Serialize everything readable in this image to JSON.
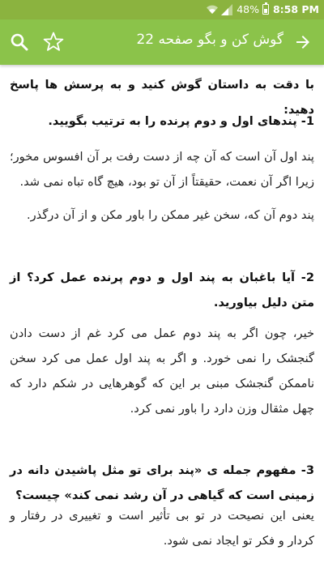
{
  "status_bar": {
    "time": "8:58 PM",
    "battery": "48%",
    "icons": [
      "wifi-icon",
      "signal-icon",
      "battery-icon"
    ]
  },
  "app_bar": {
    "title": "گوش کن و بگو صفحه 22",
    "icons": [
      "back-arrow-icon",
      "star-icon",
      "search-icon"
    ],
    "color": "#8bc34a"
  },
  "content": {
    "intro": "با دقت به داستان گوش کنید و به پرسش ها پاسخ دهید:",
    "q1": "1- پندهای اول و دوم پرنده را به ترتیب بگویید.",
    "a1_p1": "پند اول آن است که آن چه از دست رفت بر آن افسوس مخور؛ زیرا اگر آن نعمت، حقیقتاً از آن تو بود، هیچ گاه تباه نمی شد.",
    "a1_p2": "پند دوم آن که، سخن غیر ممکن را باور مکن و از آن درگذر.",
    "q2": "2- آیا باغبان به پند اول و دوم پرنده عمل کرد؟ از متن دلیل بیاورید.",
    "a2": "خیر، چون اگر به پند دوم عمل می کرد غم از دست دادن گنجشک را نمی خورد. و اگر به پند اول عمل می کرد سخن ناممکن گنجشک مبنی بر این که گوهرهایی در شکم دارد که چهل مثقال وزن دارد را باور نمی کرد.",
    "q3": "3- مفهوم جمله ی «پند برای تو مثل پاشیدن دانه در زمینی است که گیاهی در آن  رشد نمی کند» چیست؟",
    "a3": "یعنی این نصیحت در تو بی تأثیر است و تغییری در رفتار و کردار و فکر تو ایجاد نمی شود."
  }
}
